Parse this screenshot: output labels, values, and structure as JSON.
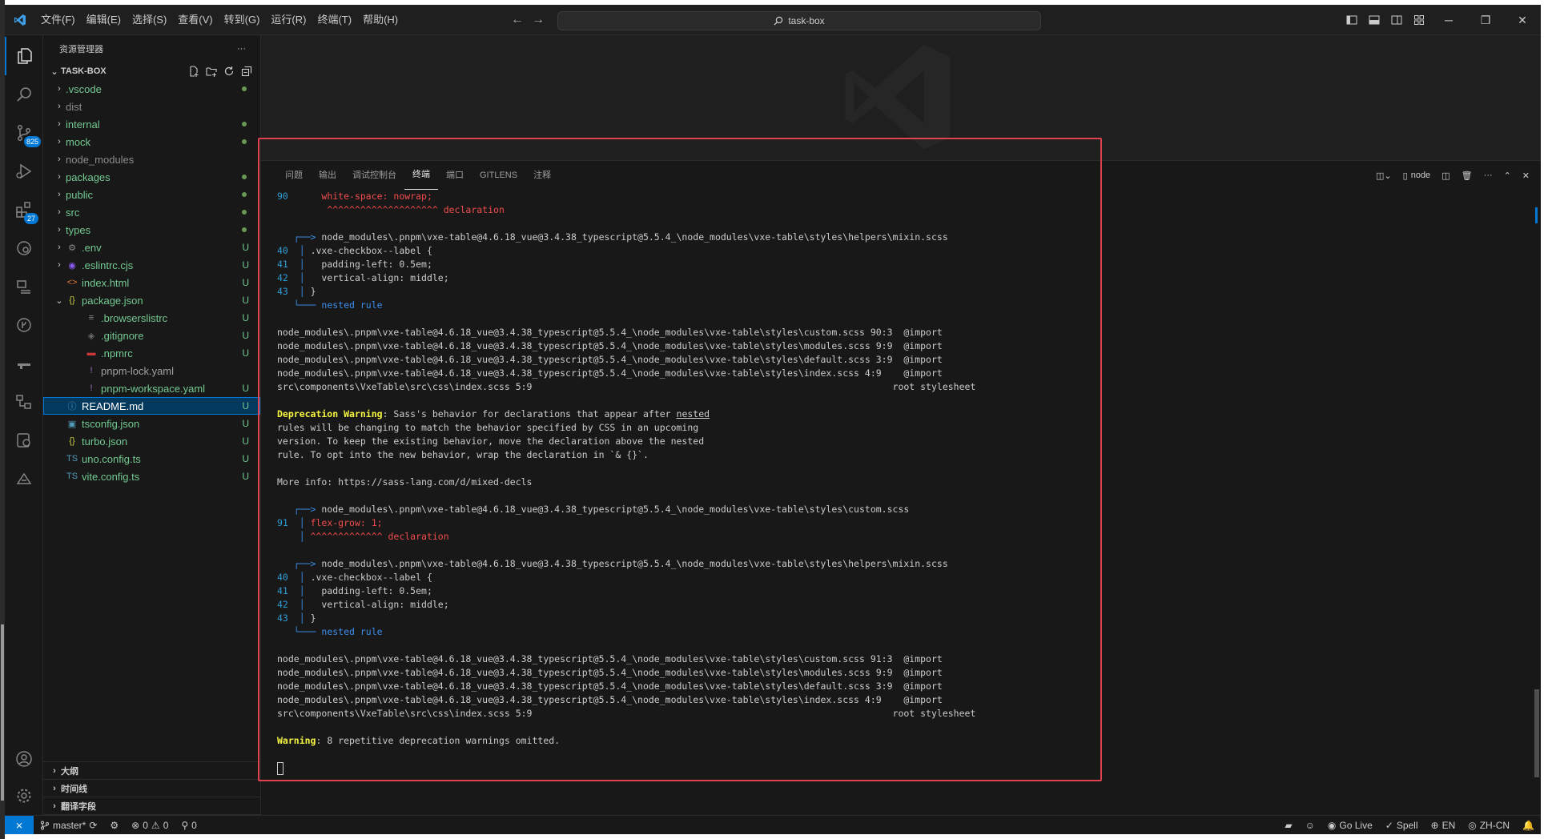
{
  "titlebar": {
    "menu": [
      "文件(F)",
      "编辑(E)",
      "选择(S)",
      "查看(V)",
      "转到(G)",
      "运行(R)",
      "终端(T)",
      "帮助(H)"
    ],
    "search_text": "task-box",
    "back_icon": "arrow-left-icon",
    "forward_icon": "arrow-right-icon"
  },
  "activitybar": {
    "scm_badge": "825",
    "extensions_badge": "27"
  },
  "sidebar": {
    "title": "资源管理器",
    "more": "···",
    "project": "TASK-BOX",
    "items": [
      {
        "name": ".vscode",
        "type": "folder",
        "status": "dot"
      },
      {
        "name": "dist",
        "type": "folder",
        "status": ""
      },
      {
        "name": "internal",
        "type": "folder",
        "status": "dot"
      },
      {
        "name": "mock",
        "type": "folder",
        "status": "dot"
      },
      {
        "name": "node_modules",
        "type": "folder",
        "status": ""
      },
      {
        "name": "packages",
        "type": "folder",
        "status": "dot"
      },
      {
        "name": "public",
        "type": "folder",
        "status": "dot"
      },
      {
        "name": "src",
        "type": "folder",
        "status": "dot"
      },
      {
        "name": "types",
        "type": "folder",
        "status": "dot"
      },
      {
        "name": ".env",
        "type": "folder",
        "status": "U"
      },
      {
        "name": ".eslintrc.cjs",
        "type": "folder",
        "status": "U"
      },
      {
        "name": "index.html",
        "type": "file",
        "status": "U"
      },
      {
        "name": "package.json",
        "type": "folder-open",
        "status": "U"
      },
      {
        "name": ".browserslistrc",
        "type": "child",
        "status": "U"
      },
      {
        "name": ".gitignore",
        "type": "child",
        "status": "U"
      },
      {
        "name": ".npmrc",
        "type": "child",
        "status": "U"
      },
      {
        "name": "pnpm-lock.yaml",
        "type": "child",
        "status": ""
      },
      {
        "name": "pnpm-workspace.yaml",
        "type": "child",
        "status": "U"
      },
      {
        "name": "README.md",
        "type": "file",
        "status": "U"
      },
      {
        "name": "tsconfig.json",
        "type": "file",
        "status": "U"
      },
      {
        "name": "turbo.json",
        "type": "file",
        "status": "U"
      },
      {
        "name": "uno.config.ts",
        "type": "file",
        "status": "U"
      },
      {
        "name": "vite.config.ts",
        "type": "file",
        "status": "U"
      }
    ],
    "bottom_sections": [
      "大纲",
      "时间线",
      "翻译字段"
    ]
  },
  "panel": {
    "tabs": [
      "问题",
      "输出",
      "调试控制台",
      "终端",
      "端口",
      "GITLENS",
      "注释"
    ],
    "active_tab": "终端",
    "terminal_name": "node"
  },
  "terminal": {
    "l90_num": "90",
    "l90_code": "white-space: nowrap;",
    "l90_mark": "^^^^^^^^^^^^^^^^^^^^ declaration",
    "mixin_path": "node_modules\\.pnpm\\vxe-table@4.6.18_vue@3.4.38_typescript@5.5.4_\\node_modules\\vxe-table\\styles\\helpers\\mixin.scss",
    "custom_path": "node_modules\\.pnpm\\vxe-table@4.6.18_vue@3.4.38_typescript@5.5.4_\\node_modules\\vxe-table\\styles\\custom.scss",
    "mixin_lines": [
      {
        "num": "40",
        "code": ".vxe-checkbox--label {"
      },
      {
        "num": "41",
        "code": "  padding-left: 0.5em;"
      },
      {
        "num": "42",
        "code": "  vertical-align: middle;"
      },
      {
        "num": "43",
        "code": "}"
      }
    ],
    "nested_rule": "nested rule",
    "stack1": [
      "node_modules\\.pnpm\\vxe-table@4.6.18_vue@3.4.38_typescript@5.5.4_\\node_modules\\vxe-table\\styles\\custom.scss 90:3  @import",
      "node_modules\\.pnpm\\vxe-table@4.6.18_vue@3.4.38_typescript@5.5.4_\\node_modules\\vxe-table\\styles\\modules.scss 9:9  @import",
      "node_modules\\.pnpm\\vxe-table@4.6.18_vue@3.4.38_typescript@5.5.4_\\node_modules\\vxe-table\\styles\\default.scss 3:9  @import",
      "node_modules\\.pnpm\\vxe-table@4.6.18_vue@3.4.38_typescript@5.5.4_\\node_modules\\vxe-table\\styles\\index.scss 4:9    @import",
      "src\\components\\VxeTable\\src\\css\\index.scss 5:9                                                                 root stylesheet"
    ],
    "deprecation_label": "Deprecation Warning",
    "deprecation_text": ": Sass's behavior for declarations that appear after ",
    "deprecation_nested": "nested",
    "deprecation_lines": [
      "rules will be changing to match the behavior specified by CSS in an upcoming",
      "version. To keep the existing behavior, move the declaration above the nested",
      "rule. To opt into the new behavior, wrap the declaration in `& {}`."
    ],
    "more_info": "More info: https://sass-lang.com/d/mixed-decls",
    "l91_num": "91",
    "l91_code": "flex-grow: 1;",
    "l91_mark": "^^^^^^^^^^^^^ declaration",
    "stack2": [
      "node_modules\\.pnpm\\vxe-table@4.6.18_vue@3.4.38_typescript@5.5.4_\\node_modules\\vxe-table\\styles\\custom.scss 91:3  @import",
      "node_modules\\.pnpm\\vxe-table@4.6.18_vue@3.4.38_typescript@5.5.4_\\node_modules\\vxe-table\\styles\\modules.scss 9:9  @import",
      "node_modules\\.pnpm\\vxe-table@4.6.18_vue@3.4.38_typescript@5.5.4_\\node_modules\\vxe-table\\styles\\default.scss 3:9  @import",
      "node_modules\\.pnpm\\vxe-table@4.6.18_vue@3.4.38_typescript@5.5.4_\\node_modules\\vxe-table\\styles\\index.scss 4:9    @import",
      "src\\components\\VxeTable\\src\\css\\index.scss 5:9                                                                 root stylesheet"
    ],
    "warning_label": "Warning",
    "warning_text": ": 8 repetitive deprecation warnings omitted."
  },
  "statusbar": {
    "branch": "master*",
    "errors": "0",
    "warnings": "0",
    "ports": "0",
    "go_live": "Go Live",
    "spell": "Spell",
    "lang1": "EN",
    "lang2": "ZH-CN"
  },
  "colors": {
    "accent": "#0078d4",
    "highlight_border": "#e0424f",
    "error_red": "#f14c4c",
    "warning_yellow": "#f5f543",
    "line_number_blue": "#2f9cd4"
  }
}
